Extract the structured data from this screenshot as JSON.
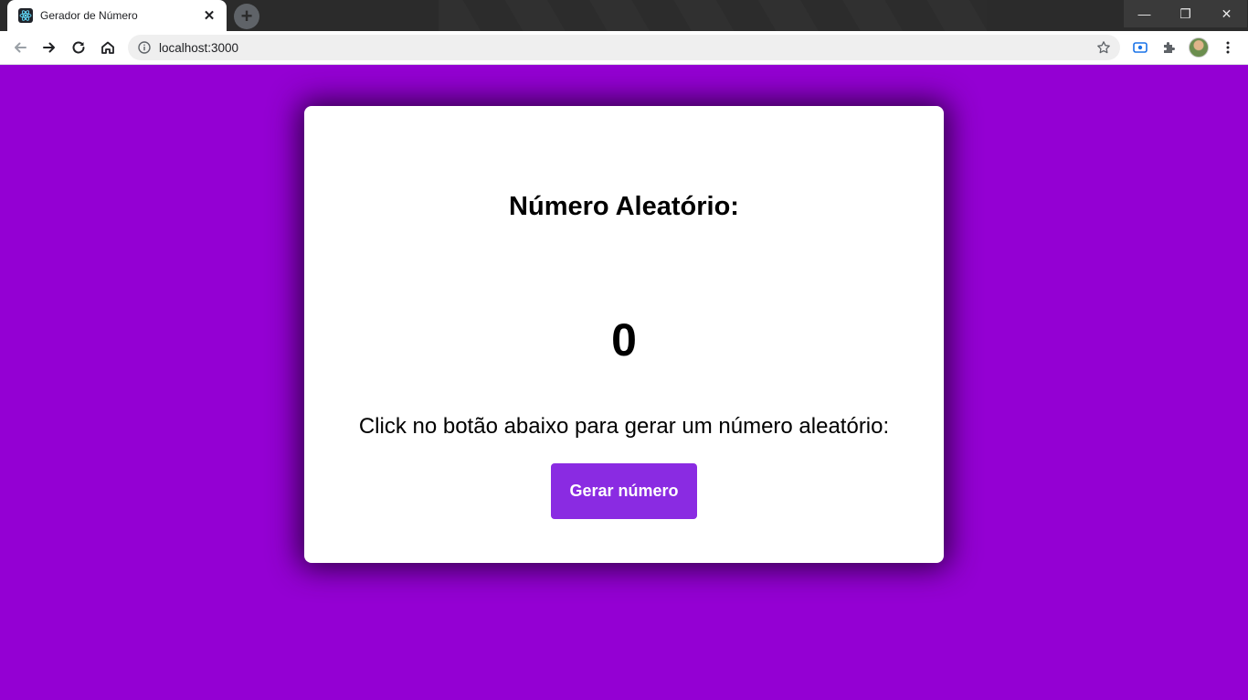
{
  "browser": {
    "tab": {
      "title": "Gerador de Número",
      "close_glyph": "✕",
      "favicon": "react-logo-icon"
    },
    "new_tab_glyph": "+",
    "window_controls": {
      "minimize": "—",
      "maximize": "❐",
      "close": "✕"
    },
    "address": {
      "url": "localhost:3000"
    }
  },
  "page": {
    "background_color": "#9400d3",
    "card": {
      "title": "Número Aleatório:",
      "number": "0",
      "instruction": "Click no botão abaixo para gerar um número aleatório:",
      "button_label": "Gerar número",
      "button_color": "#8a2be2"
    }
  }
}
